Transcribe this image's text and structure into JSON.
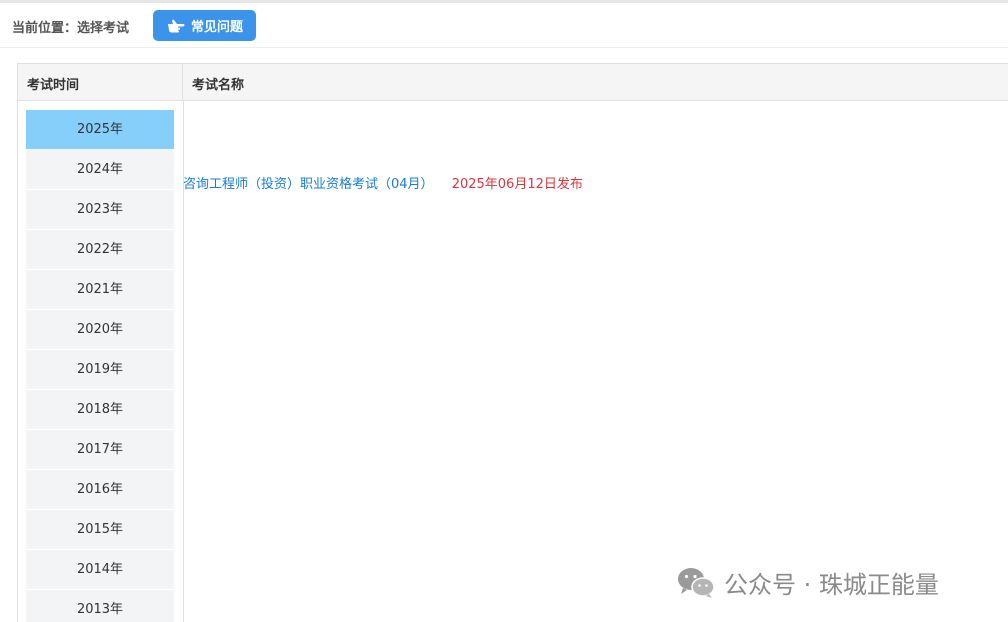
{
  "header": {
    "breadcrumb": "当前位置：选择考试",
    "faq_button": "常见问题",
    "faq_icon": "pointing-hand-icon"
  },
  "table": {
    "col_time": "考试时间",
    "col_name": "考试名称"
  },
  "years": [
    {
      "label": "2025年",
      "active": true
    },
    {
      "label": "2024年"
    },
    {
      "label": "2023年"
    },
    {
      "label": "2022年"
    },
    {
      "label": "2021年"
    },
    {
      "label": "2020年"
    },
    {
      "label": "2019年"
    },
    {
      "label": "2018年"
    },
    {
      "label": "2017年"
    },
    {
      "label": "2016年"
    },
    {
      "label": "2015年"
    },
    {
      "label": "2014年"
    },
    {
      "label": "2013年"
    }
  ],
  "exam": {
    "title": "咨询工程师（投资）职业资格考试（04月）",
    "published": "2025年06月12日发布"
  },
  "watermark": {
    "text": "公众号 · 珠城正能量",
    "icon": "wechat-icon"
  },
  "colors": {
    "accent": "#3b93ea",
    "active_year": "#86cffa",
    "link": "#1a7bd6",
    "date": "#d9363e"
  }
}
